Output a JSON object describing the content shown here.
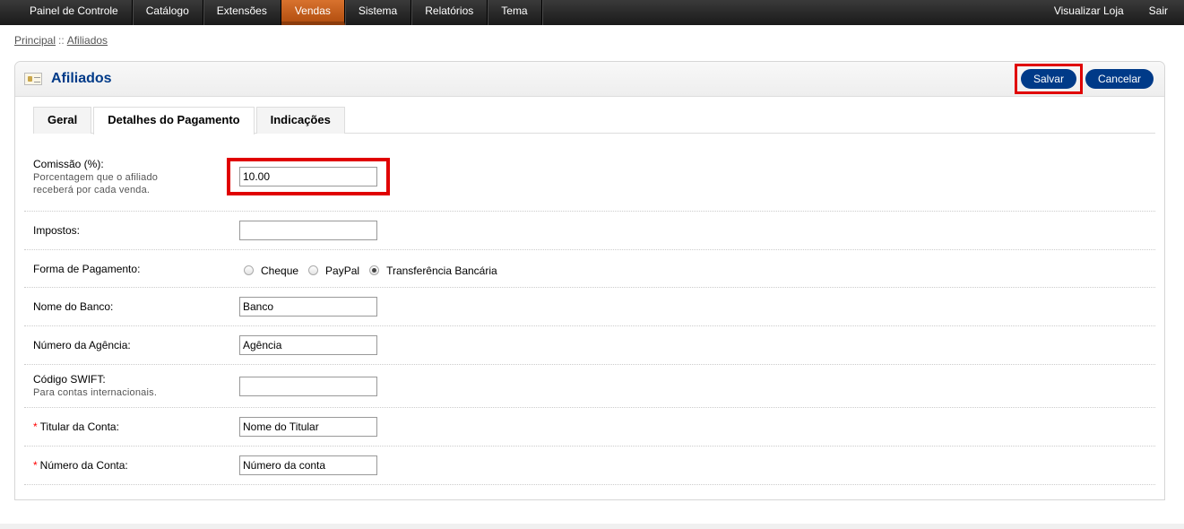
{
  "nav": {
    "left": [
      "Painel de Controle",
      "Catálogo",
      "Extensões",
      "Vendas",
      "Sistema",
      "Relatórios",
      "Tema"
    ],
    "right": [
      "Visualizar Loja",
      "Sair"
    ],
    "active_index": 3
  },
  "breadcrumb": {
    "home": "Principal",
    "separator": "::",
    "current": "Afiliados"
  },
  "heading": {
    "title": "Afiliados",
    "save_label": "Salvar",
    "cancel_label": "Cancelar"
  },
  "tabs": [
    "Geral",
    "Detalhes do Pagamento",
    "Indicações"
  ],
  "active_tab": 1,
  "form": {
    "commission": {
      "label": "Comissão (%):",
      "help_line1": "Porcentagem que o afiliado",
      "help_line2": "receberá por cada venda.",
      "value": "10.00"
    },
    "tax": {
      "label": "Impostos:",
      "value": ""
    },
    "payment": {
      "label": "Forma de Pagamento:",
      "options": [
        "Cheque",
        "PayPal",
        "Transferência Bancária"
      ],
      "selected": 2
    },
    "bank_name": {
      "label": "Nome do Banco:",
      "value": "Banco"
    },
    "branch": {
      "label": "Número da Agência:",
      "value": "Agência"
    },
    "swift": {
      "label": "Código SWIFT:",
      "help": "Para contas internacionais.",
      "value": ""
    },
    "holder": {
      "required": "*",
      "label": "Titular da Conta:",
      "value": "Nome do Titular"
    },
    "account": {
      "required": "*",
      "label": "Número da Conta:",
      "value": "Número da conta"
    }
  },
  "colors": {
    "accent": "#003a88",
    "active_nav": "#c8601f",
    "highlight": "#e00000",
    "required": "#ff0000"
  }
}
